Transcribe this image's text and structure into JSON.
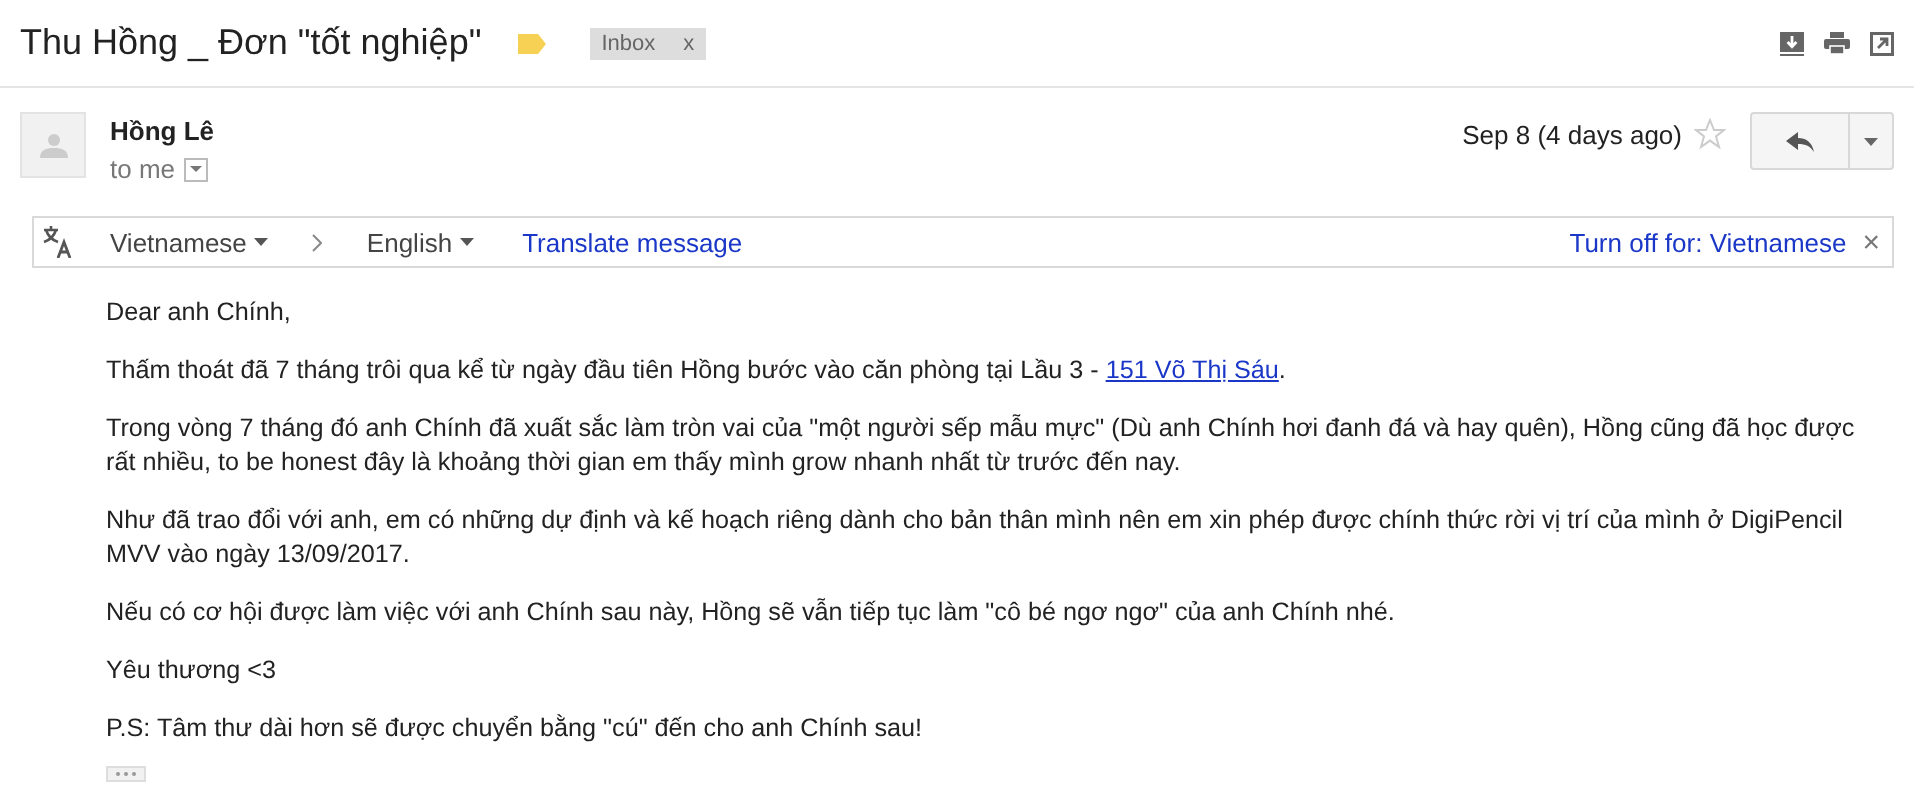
{
  "subject": "Thu Hồng _ Đơn \"tốt nghiệp\"",
  "labels": [
    {
      "text": "Inbox",
      "remove": "x"
    }
  ],
  "sender": {
    "name": "Hồng Lê",
    "recipient": "to me",
    "date": "Sep 8 (4 days ago)",
    "starred": false
  },
  "translate_bar": {
    "source": "Vietnamese",
    "target": "English",
    "action": "Translate message",
    "turn_off": "Turn off for: Vietnamese",
    "close": "×"
  },
  "body": [
    {
      "parts": [
        {
          "kind": "text",
          "text": "Dear anh Chính,"
        }
      ]
    },
    {
      "parts": [
        {
          "kind": "text",
          "text": "Thấm thoát đã 7 tháng trôi qua kể từ ngày đầu tiên Hồng bước vào căn phòng tại Lầu 3 - "
        },
        {
          "kind": "link",
          "text": "151 Võ Thị Sáu"
        },
        {
          "kind": "text",
          "text": "."
        }
      ]
    },
    {
      "parts": [
        {
          "kind": "text",
          "text": "Trong vòng 7 tháng đó anh Chính đã xuất sắc làm tròn vai của \"một người sếp mẫu mực\" (Dù anh Chính hơi đanh đá và hay quên), Hồng cũng đã học được rất nhiều, to be honest đây là khoảng thời gian em thấy mình grow nhanh nhất từ trước đến nay."
        }
      ]
    },
    {
      "parts": [
        {
          "kind": "text",
          "text": "Như đã trao đổi với anh, em có những dự định và kế hoạch riêng dành cho bản thân mình nên em xin phép được chính thức rời vị trí của mình ở DigiPencil MVV vào ngày 13/09/2017."
        }
      ]
    },
    {
      "parts": [
        {
          "kind": "text",
          "text": "Nếu có cơ hội được làm việc với anh Chính sau này, Hồng sẽ vẫn tiếp tục làm \"cô bé ngơ ngơ\" của anh Chính nhé."
        }
      ]
    },
    {
      "parts": [
        {
          "kind": "text",
          "text": "Yêu thương <3"
        }
      ]
    },
    {
      "parts": [
        {
          "kind": "text",
          "text": "P.S: Tâm thư dài hơn sẽ được chuyển bằng \"cú\" đến cho anh Chính sau!"
        }
      ]
    }
  ]
}
